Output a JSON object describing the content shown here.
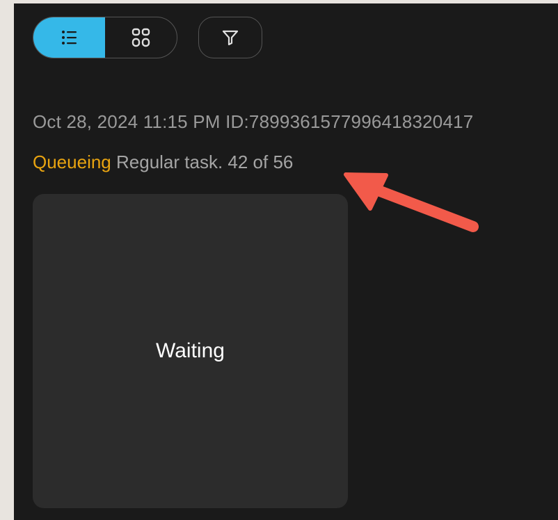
{
  "toolbar": {
    "list_view_icon": "list-icon",
    "grid_view_icon": "grid-icon",
    "filter_icon": "filter-icon",
    "accent_color": "#35b8e8"
  },
  "task": {
    "datetime": "Oct 28, 2024 11:15 PM",
    "id_text": "ID:789936157799641832041‌7",
    "status": "Queueing",
    "status_color": "#e9a410",
    "description": "Regular task. 42 of 56"
  },
  "preview": {
    "label": "Waiting"
  },
  "annotation": {
    "arrow_color": "#f25a4a"
  }
}
